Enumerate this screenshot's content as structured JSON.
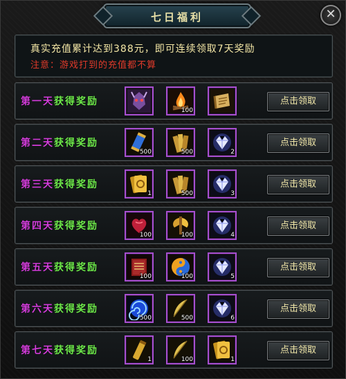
{
  "window": {
    "title": "七日福利"
  },
  "notice": {
    "line1": "真实充值累计达到388元，即可连续领取7天奖励",
    "line2": "注意：游戏打到的充值都不算"
  },
  "claim_label": "点击领取",
  "rows": [
    {
      "prefix": "第一天",
      "suffix": "获得奖励",
      "items": [
        {
          "icon": "demon-mask-icon",
          "count": ""
        },
        {
          "icon": "campfire-icon",
          "count": "100"
        },
        {
          "icon": "scroll-icon",
          "count": ""
        }
      ]
    },
    {
      "prefix": "第二天",
      "suffix": "获得奖励",
      "items": [
        {
          "icon": "blue-scroll-icon",
          "count": "500"
        },
        {
          "icon": "gold-scroll-stack-icon",
          "count": "500"
        },
        {
          "icon": "diamond-icon",
          "count": "2"
        }
      ]
    },
    {
      "prefix": "第三天",
      "suffix": "获得奖励",
      "items": [
        {
          "icon": "gold-card-icon",
          "count": "1"
        },
        {
          "icon": "gold-scroll-stack-icon",
          "count": "500"
        },
        {
          "icon": "diamond-icon",
          "count": "3"
        }
      ]
    },
    {
      "prefix": "第四天",
      "suffix": "获得奖励",
      "items": [
        {
          "icon": "heart-icon",
          "count": "100"
        },
        {
          "icon": "gold-axe-icon",
          "count": "100"
        },
        {
          "icon": "diamond-icon",
          "count": "4"
        }
      ]
    },
    {
      "prefix": "第五天",
      "suffix": "获得奖励",
      "items": [
        {
          "icon": "book-icon",
          "count": "100"
        },
        {
          "icon": "yin-yang-icon",
          "count": "100"
        },
        {
          "icon": "diamond-icon",
          "count": "5"
        }
      ]
    },
    {
      "prefix": "第六天",
      "suffix": "获得奖励",
      "items": [
        {
          "icon": "blue-vortex-icon",
          "count": "500"
        },
        {
          "icon": "feather-icon",
          "count": "500"
        },
        {
          "icon": "diamond-icon",
          "count": "6"
        }
      ]
    },
    {
      "prefix": "第七天",
      "suffix": "获得奖励",
      "items": [
        {
          "icon": "gold-tube-icon",
          "count": "1"
        },
        {
          "icon": "feather-icon",
          "count": "100"
        },
        {
          "icon": "gold-card-icon",
          "count": "1"
        }
      ]
    }
  ]
}
